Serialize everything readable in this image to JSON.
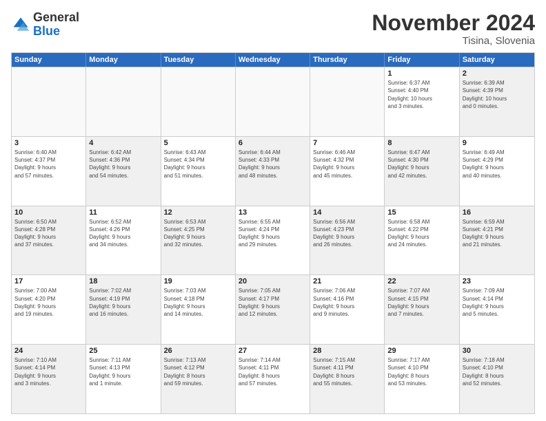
{
  "logo": {
    "general": "General",
    "blue": "Blue"
  },
  "title": "November 2024",
  "location": "Tisina, Slovenia",
  "header": {
    "days": [
      "Sunday",
      "Monday",
      "Tuesday",
      "Wednesday",
      "Thursday",
      "Friday",
      "Saturday"
    ]
  },
  "weeks": [
    [
      {
        "day": "",
        "info": "",
        "empty": true
      },
      {
        "day": "",
        "info": "",
        "empty": true
      },
      {
        "day": "",
        "info": "",
        "empty": true
      },
      {
        "day": "",
        "info": "",
        "empty": true
      },
      {
        "day": "",
        "info": "",
        "empty": true
      },
      {
        "day": "1",
        "info": "Sunrise: 6:37 AM\nSunset: 4:40 PM\nDaylight: 10 hours\nand 3 minutes.",
        "empty": false
      },
      {
        "day": "2",
        "info": "Sunrise: 6:39 AM\nSunset: 4:39 PM\nDaylight: 10 hours\nand 0 minutes.",
        "empty": false,
        "shaded": true
      }
    ],
    [
      {
        "day": "3",
        "info": "Sunrise: 6:40 AM\nSunset: 4:37 PM\nDaylight: 9 hours\nand 57 minutes.",
        "empty": false
      },
      {
        "day": "4",
        "info": "Sunrise: 6:42 AM\nSunset: 4:36 PM\nDaylight: 9 hours\nand 54 minutes.",
        "empty": false,
        "shaded": true
      },
      {
        "day": "5",
        "info": "Sunrise: 6:43 AM\nSunset: 4:34 PM\nDaylight: 9 hours\nand 51 minutes.",
        "empty": false
      },
      {
        "day": "6",
        "info": "Sunrise: 6:44 AM\nSunset: 4:33 PM\nDaylight: 9 hours\nand 48 minutes.",
        "empty": false,
        "shaded": true
      },
      {
        "day": "7",
        "info": "Sunrise: 6:46 AM\nSunset: 4:32 PM\nDaylight: 9 hours\nand 45 minutes.",
        "empty": false
      },
      {
        "day": "8",
        "info": "Sunrise: 6:47 AM\nSunset: 4:30 PM\nDaylight: 9 hours\nand 42 minutes.",
        "empty": false,
        "shaded": true
      },
      {
        "day": "9",
        "info": "Sunrise: 6:49 AM\nSunset: 4:29 PM\nDaylight: 9 hours\nand 40 minutes.",
        "empty": false
      }
    ],
    [
      {
        "day": "10",
        "info": "Sunrise: 6:50 AM\nSunset: 4:28 PM\nDaylight: 9 hours\nand 37 minutes.",
        "empty": false,
        "shaded": true
      },
      {
        "day": "11",
        "info": "Sunrise: 6:52 AM\nSunset: 4:26 PM\nDaylight: 9 hours\nand 34 minutes.",
        "empty": false
      },
      {
        "day": "12",
        "info": "Sunrise: 6:53 AM\nSunset: 4:25 PM\nDaylight: 9 hours\nand 32 minutes.",
        "empty": false,
        "shaded": true
      },
      {
        "day": "13",
        "info": "Sunrise: 6:55 AM\nSunset: 4:24 PM\nDaylight: 9 hours\nand 29 minutes.",
        "empty": false
      },
      {
        "day": "14",
        "info": "Sunrise: 6:56 AM\nSunset: 4:23 PM\nDaylight: 9 hours\nand 26 minutes.",
        "empty": false,
        "shaded": true
      },
      {
        "day": "15",
        "info": "Sunrise: 6:58 AM\nSunset: 4:22 PM\nDaylight: 9 hours\nand 24 minutes.",
        "empty": false
      },
      {
        "day": "16",
        "info": "Sunrise: 6:59 AM\nSunset: 4:21 PM\nDaylight: 9 hours\nand 21 minutes.",
        "empty": false,
        "shaded": true
      }
    ],
    [
      {
        "day": "17",
        "info": "Sunrise: 7:00 AM\nSunset: 4:20 PM\nDaylight: 9 hours\nand 19 minutes.",
        "empty": false
      },
      {
        "day": "18",
        "info": "Sunrise: 7:02 AM\nSunset: 4:19 PM\nDaylight: 9 hours\nand 16 minutes.",
        "empty": false,
        "shaded": true
      },
      {
        "day": "19",
        "info": "Sunrise: 7:03 AM\nSunset: 4:18 PM\nDaylight: 9 hours\nand 14 minutes.",
        "empty": false
      },
      {
        "day": "20",
        "info": "Sunrise: 7:05 AM\nSunset: 4:17 PM\nDaylight: 9 hours\nand 12 minutes.",
        "empty": false,
        "shaded": true
      },
      {
        "day": "21",
        "info": "Sunrise: 7:06 AM\nSunset: 4:16 PM\nDaylight: 9 hours\nand 9 minutes.",
        "empty": false
      },
      {
        "day": "22",
        "info": "Sunrise: 7:07 AM\nSunset: 4:15 PM\nDaylight: 9 hours\nand 7 minutes.",
        "empty": false,
        "shaded": true
      },
      {
        "day": "23",
        "info": "Sunrise: 7:09 AM\nSunset: 4:14 PM\nDaylight: 9 hours\nand 5 minutes.",
        "empty": false
      }
    ],
    [
      {
        "day": "24",
        "info": "Sunrise: 7:10 AM\nSunset: 4:14 PM\nDaylight: 9 hours\nand 3 minutes.",
        "empty": false,
        "shaded": true
      },
      {
        "day": "25",
        "info": "Sunrise: 7:11 AM\nSunset: 4:13 PM\nDaylight: 9 hours\nand 1 minute.",
        "empty": false
      },
      {
        "day": "26",
        "info": "Sunrise: 7:13 AM\nSunset: 4:12 PM\nDaylight: 8 hours\nand 59 minutes.",
        "empty": false,
        "shaded": true
      },
      {
        "day": "27",
        "info": "Sunrise: 7:14 AM\nSunset: 4:11 PM\nDaylight: 8 hours\nand 57 minutes.",
        "empty": false
      },
      {
        "day": "28",
        "info": "Sunrise: 7:15 AM\nSunset: 4:11 PM\nDaylight: 8 hours\nand 55 minutes.",
        "empty": false,
        "shaded": true
      },
      {
        "day": "29",
        "info": "Sunrise: 7:17 AM\nSunset: 4:10 PM\nDaylight: 8 hours\nand 53 minutes.",
        "empty": false
      },
      {
        "day": "30",
        "info": "Sunrise: 7:18 AM\nSunset: 4:10 PM\nDaylight: 8 hours\nand 52 minutes.",
        "empty": false,
        "shaded": true
      }
    ]
  ]
}
